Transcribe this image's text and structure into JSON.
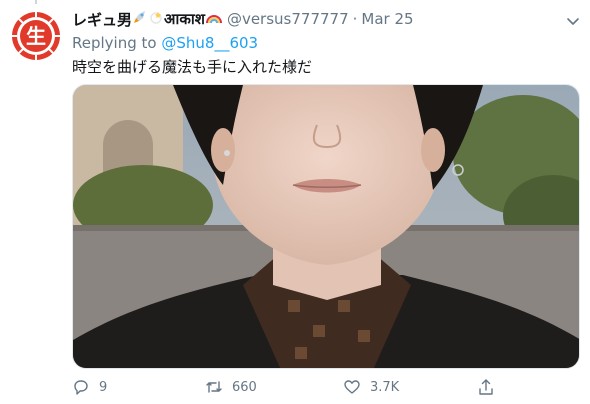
{
  "tweet": {
    "display_name": "レギュ男",
    "name_suffix": "आकाश",
    "emoji": [
      "rocket-emoji",
      "dizzy-emoji",
      "rainbow-emoji"
    ],
    "handle": "@versus777777",
    "separator": "·",
    "date": "Mar 25",
    "replying_to_label": "Replying to",
    "replying_to_handle": "@Shu8__603",
    "text": "時空を曲げる魔法も手に入れた様だ",
    "avatar_glyph": "生"
  },
  "actions": {
    "reply_count": "9",
    "retweet_count": "660",
    "like_count": "3.7K"
  },
  "colors": {
    "link": "#1da1f2",
    "muted": "#657786",
    "avatar_red": "#e23a2a"
  }
}
